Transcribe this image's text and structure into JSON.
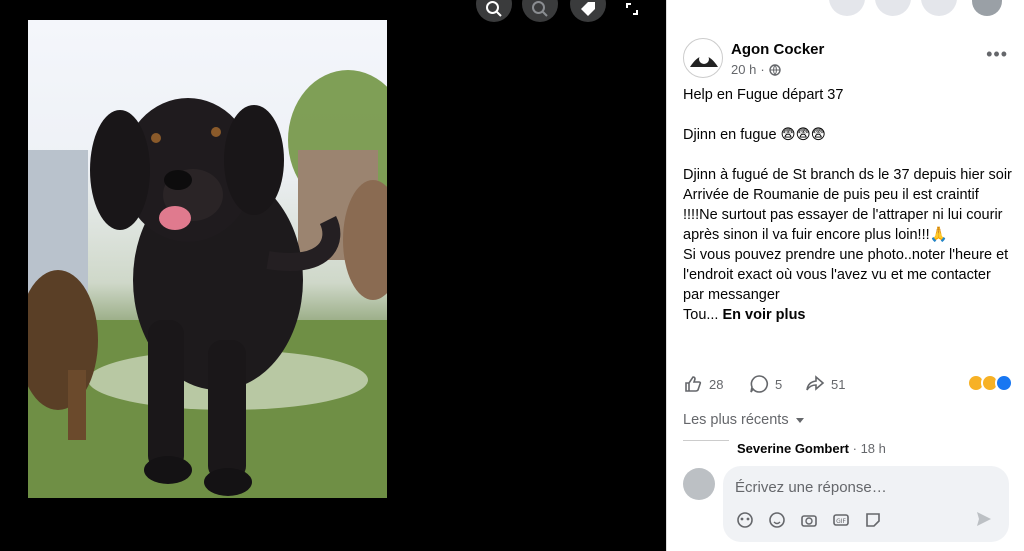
{
  "post": {
    "author": "Agon Cocker",
    "time": "20 h",
    "meta_sep": "·",
    "more_label": "•••",
    "paragraphs": [
      "Help en Fugue départ 37",
      "Djinn en fugue 😨😨😨",
      "Djinn à fugué de St branch ds le 37 depuis hier soir",
      "Arrivée de Roumanie de puis peu il est craintif !!!!Ne surtout pas essayer de l'attraper ni lui courir après sinon il va fuir encore plus loin!!!🙏",
      "Si vous pouvez prendre une photo..noter l'heure et l'endroit exact où vous l'avez vu et me contacter par messanger"
    ],
    "truncated_prefix": "Tou...",
    "see_more": "En voir plus"
  },
  "stats": {
    "likes": "28",
    "comments": "5",
    "shares": "51"
  },
  "comments": {
    "sort_label": "Les plus récents",
    "items": [
      {
        "author": "Severine Gombert",
        "time": "· 18 h"
      }
    ],
    "reply_placeholder": "Écrivez une réponse…"
  },
  "icons": {
    "viewer": [
      "zoom-in-icon",
      "zoom-out-icon",
      "tag-icon",
      "fullscreen-icon"
    ],
    "tools": [
      "avatar-sticker-icon",
      "emoji-icon",
      "camera-icon",
      "gif-icon",
      "sticker-icon"
    ]
  },
  "colors": {
    "text": "#050505",
    "secondary": "#65676b",
    "input_bg": "#f0f2f5"
  }
}
